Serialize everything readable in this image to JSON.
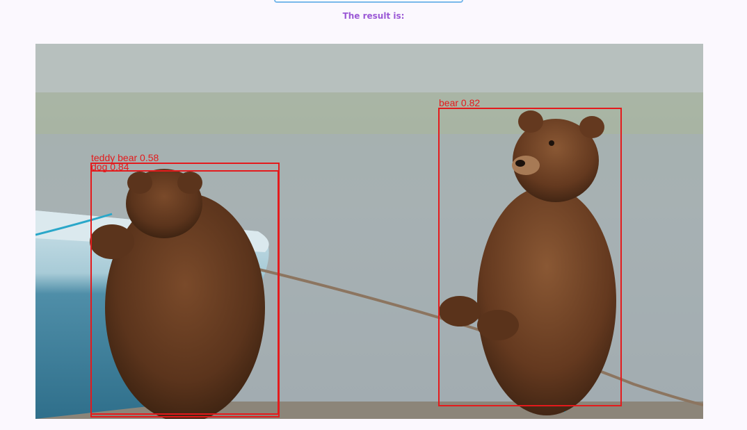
{
  "result": {
    "title": "The result is:"
  },
  "image": {
    "description_icon": "photo-of-two-bear-cubs"
  },
  "detections": [
    {
      "label": "teddy bear 0.58",
      "color": "#e41a1c"
    },
    {
      "label": "dog 0.84",
      "color": "#e41a1c"
    },
    {
      "label": "bear 0.82",
      "color": "#e41a1c"
    }
  ]
}
